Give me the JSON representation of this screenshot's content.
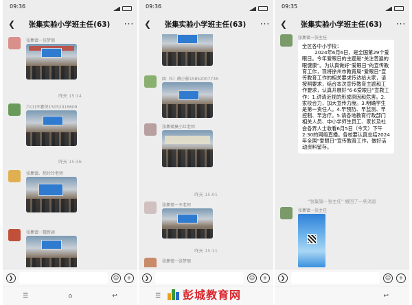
{
  "panels": [
    {
      "status": {
        "time": "09:36"
      },
      "header": {
        "title": "张集实验小学班主任(63)"
      },
      "messages": [
        {
          "sender": "张集镇－张梦丽"
        },
        {
          "timestamp": "昨天 15:14"
        },
        {
          "sender": "六(1)王春侠15052016609"
        },
        {
          "timestamp": "昨天 15:46"
        },
        {
          "sender": "张集镇、杨玲玲老师"
        },
        {
          "sender": "张集镇－魏新颖"
        }
      ]
    },
    {
      "status": {
        "time": "09:36"
      },
      "header": {
        "title": "张集实验小学班主任(63)"
      },
      "messages": [
        {
          "sender": "四（5）薛小影15852007736"
        },
        {
          "sender": "张集镇莫小红老师"
        },
        {
          "timestamp": "昨天 15:01"
        },
        {
          "sender": "张集镇－王老师"
        },
        {
          "timestamp": "昨天 15:11"
        },
        {
          "sender": "张集镇－张梦丽"
        }
      ]
    },
    {
      "status": {
        "time": "09:35"
      },
      "header": {
        "title": "张集实验小学班主任(63)"
      },
      "messages": [
        {
          "sender": "张集镇－张主任"
        },
        {
          "text": "全区各中小学校：\n        2024年6月6日，是全国第29个爱眼日。今年爱眼日的主题是“关注普遍的眼健康”。为认真做好“爱眼日”的宣传教育工作，现将徐州市教育局“爱眼日”宣传教育工作的相关要求传达给大家，请按照要求，结合本次宣传教育主题和工作要求，认真开展好“6·6爱眼日”宣教工作：1.讲清近视的形成原因和危害。2.家校合力，加大宣传力度。3.明确学生是第一责任人。4.早预防、早监测、早控制、早治疗。5.请各地教育行政部门相关人员、中小学师生员工、家长及社会各界人士收看6月5日（今天）下午2:30的网络直播。各校要认真总结2024年全国“爱眼日”宣传教育工作，做好活动资料留存。"
        },
        {
          "recall": "“张集镇－张主任” 撤回了一条消息"
        },
        {
          "sender": "张集镇－张主任"
        }
      ]
    }
  ],
  "watermark": {
    "text": "彭城教育网"
  }
}
